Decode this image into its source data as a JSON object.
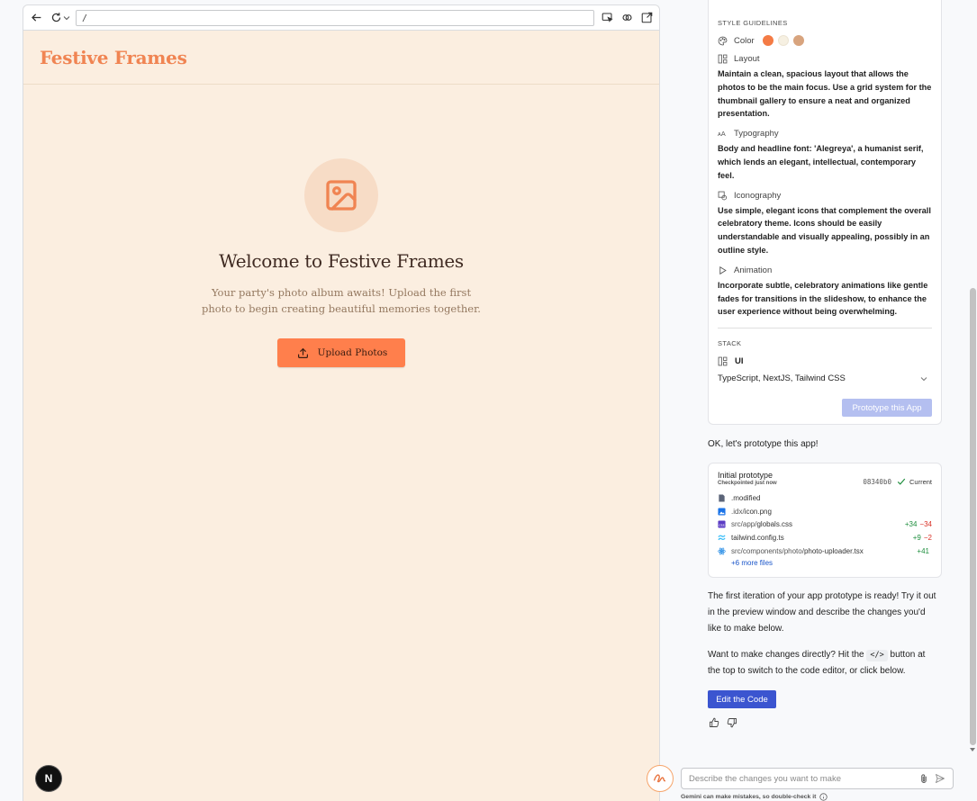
{
  "preview": {
    "url": "/",
    "brand": "Festive Frames",
    "hero_title": "Welcome to Festive Frames",
    "hero_subtitle": "Your party's photo album awaits! Upload the first photo to begin creating beautiful memories together.",
    "upload_label": "Upload Photos",
    "badge_letter": "N",
    "colors": {
      "brand": "#f08452",
      "background": "#fbeee0",
      "button": "#ff7f4c"
    }
  },
  "guidelines": {
    "section_title": "STYLE GUIDELINES",
    "color_label": "Color",
    "color_swatches": [
      "#f47b45",
      "#f6f0e2",
      "#d8a47e"
    ],
    "layout_label": "Layout",
    "layout_text": "Maintain a clean, spacious layout that allows the photos to be the main focus. Use a grid system for the thumbnail gallery to ensure a neat and organized presentation.",
    "typography_label": "Typography",
    "typography_text": "Body and headline font: 'Alegreya', a humanist serif, which lends an elegant, intellectual, contemporary feel.",
    "iconography_label": "Iconography",
    "iconography_text": "Use simple, elegant icons that complement the overall celebratory theme. Icons should be easily understandable and visually appealing, possibly in an outline style.",
    "animation_label": "Animation",
    "animation_text": "Incorporate subtle, celebratory animations like gentle fades for transitions in the slideshow, to enhance the user experience without being overwhelming.",
    "stack_title": "STACK",
    "stack_ui_label": "UI",
    "stack_tech": "TypeScript, NextJS, Tailwind CSS",
    "prototype_button": "Prototype this App"
  },
  "chat": {
    "ok_message": "OK, let's prototype this app!",
    "checkpoint": {
      "title": "Initial prototype",
      "subtitle": "Checkpointed just now",
      "hash": "08340b0",
      "status": "Current",
      "files": [
        {
          "dir": "",
          "name": ".modified",
          "icon": "file-icon",
          "added": "",
          "removed": ""
        },
        {
          "dir": ".idx/",
          "name": "icon.png",
          "icon": "image-icon",
          "added": "",
          "removed": ""
        },
        {
          "dir": "src/app/",
          "name": "globals.css",
          "icon": "css-icon",
          "added": "+34",
          "removed": "−34"
        },
        {
          "dir": "",
          "name": "tailwind.config.ts",
          "icon": "tailwind-icon",
          "added": "+9",
          "removed": "−2"
        },
        {
          "dir": "src/components/photo/",
          "name": "photo-uploader.tsx",
          "icon": "react-icon",
          "added": "+41",
          "removed": ""
        }
      ],
      "more_files": "+6 more files"
    },
    "ready_message": "The first iteration of your app prototype is ready! Try it out in the preview window and describe the changes you'd like to make below.",
    "changes_pre": "Want to make changes directly? Hit the",
    "code_chip": "</>",
    "changes_post": "button at the top to switch to the code editor, or click below.",
    "edit_button": "Edit the Code"
  },
  "input": {
    "placeholder": "Describe the changes you want to make",
    "disclaimer": "Gemini can make mistakes, so double-check it"
  }
}
